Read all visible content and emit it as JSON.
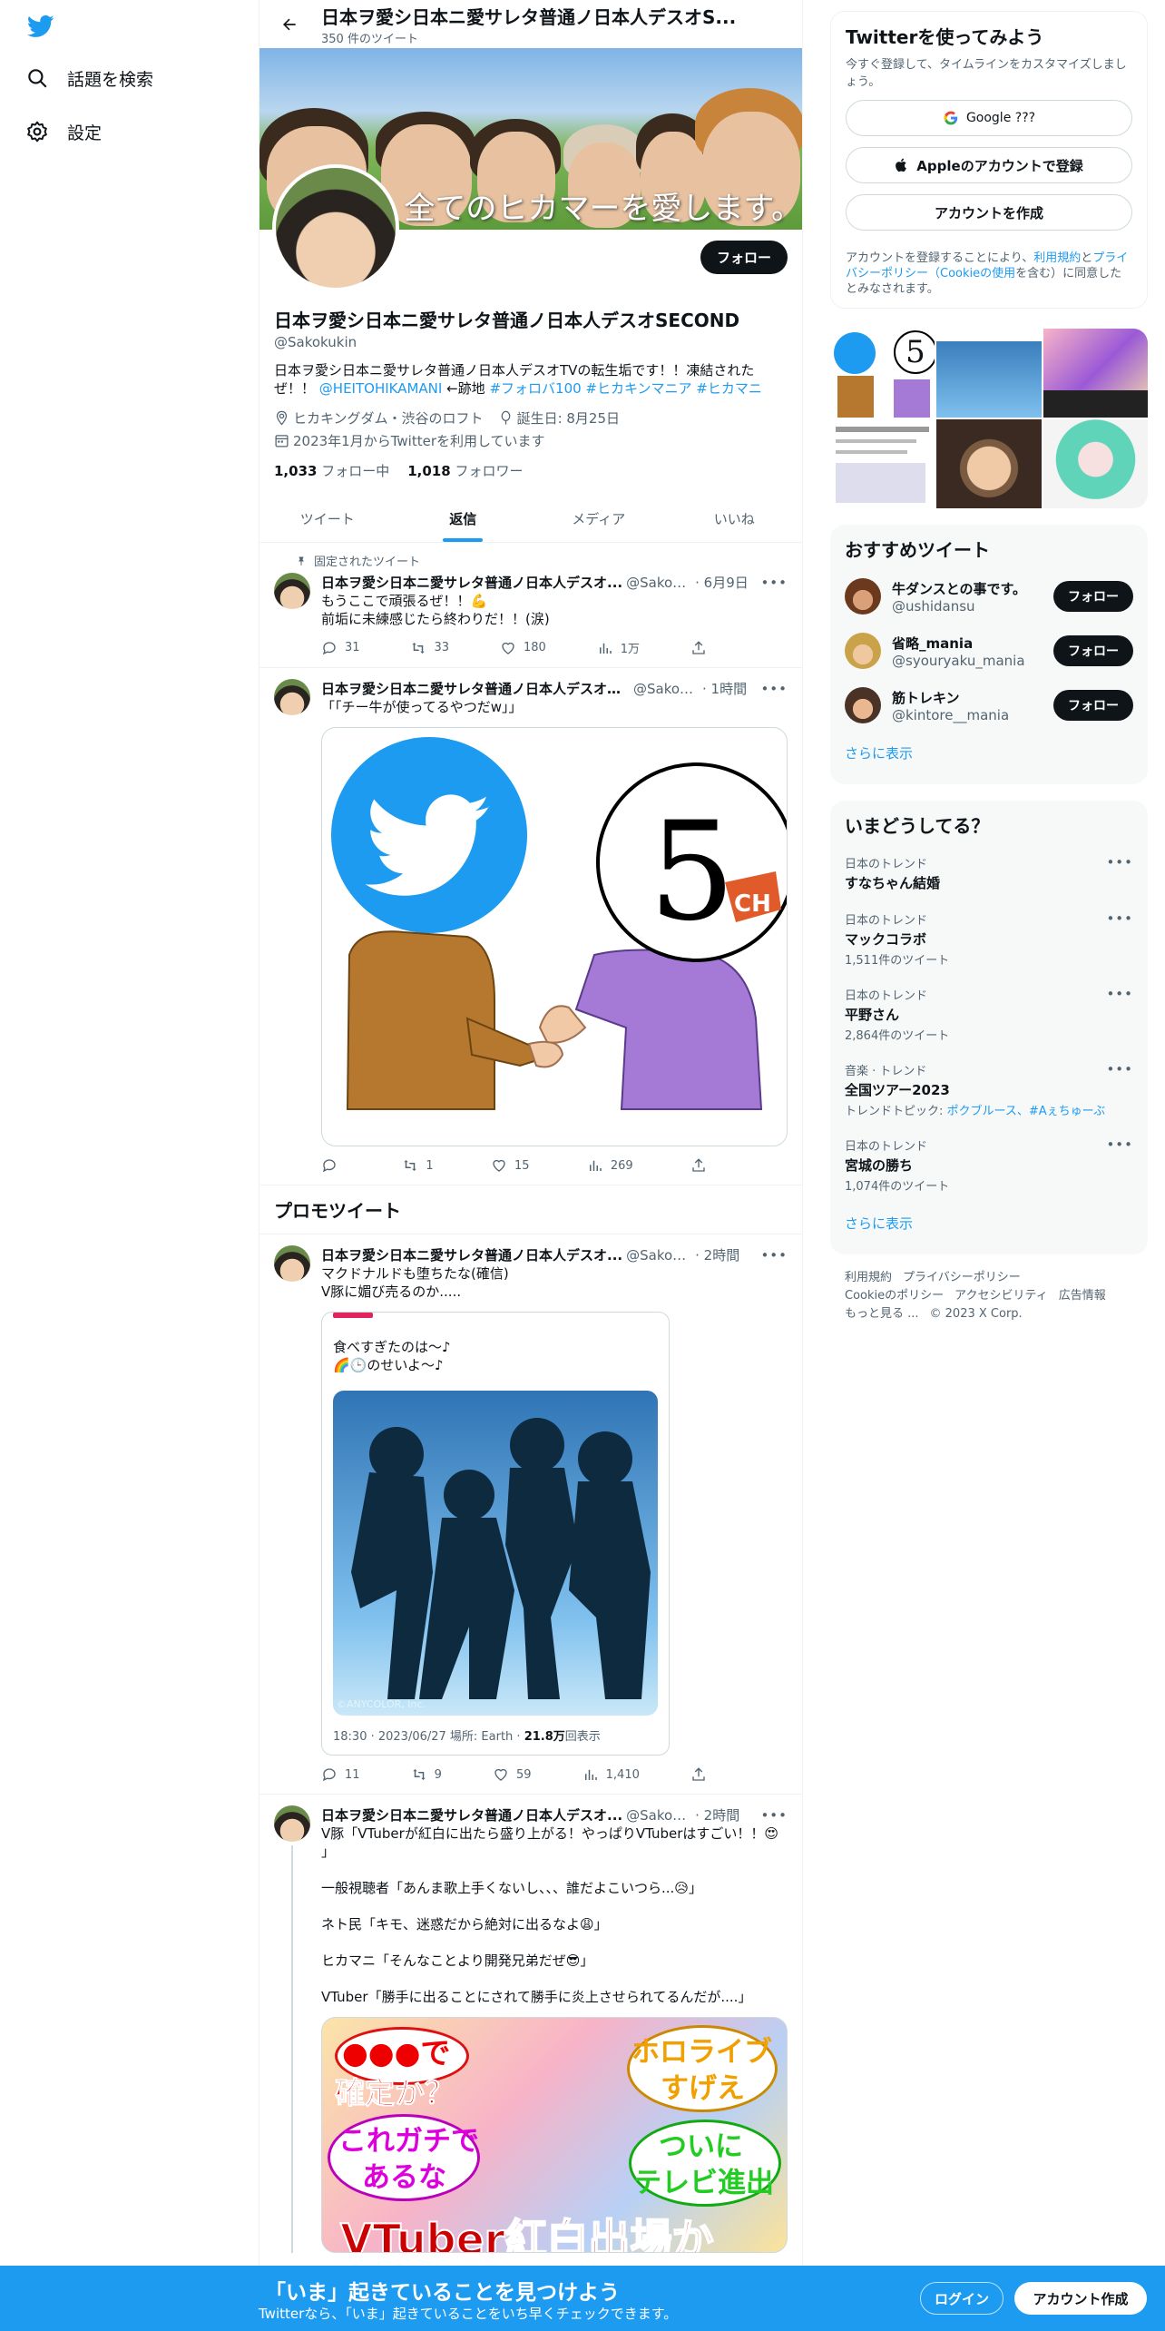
{
  "nav": {
    "explore_label": "話題を検索",
    "settings_label": "設定"
  },
  "header": {
    "title": "日本ヲ愛シ日本ニ愛サレタ普通ノ日本人デスオS...",
    "tweet_count": "350 件のツイート"
  },
  "banner": {
    "caption": "全てのヒカマーを愛します。"
  },
  "profile": {
    "follow_label": "フォロー",
    "name": "日本ヲ愛シ日本ニ愛サレタ普通ノ日本人デスオSECOND",
    "handle": "@Sakokukin",
    "bio_text": "日本ヲ愛シ日本ニ愛サレタ普通ノ日本人デスオTVの転生垢です！！凍結された",
    "bio_text2": "ぜ！！",
    "bio_mention": "@HEITOHIKAMANI",
    "bio_mid": " ←跡地 ",
    "bio_tags": "#フォロバ100 #ヒカキンマニア #ヒカマニ",
    "location": "ヒカキングダム・渋谷のロフト",
    "birthday": "誕生日: 8月25日",
    "joined": "2023年1月からTwitterを利用しています",
    "following_count": "1,033",
    "following_label": " フォロー中",
    "followers_count": "1,018",
    "followers_label": " フォロワー"
  },
  "tabs": [
    "ツイート",
    "返信",
    "メディア",
    "いいね"
  ],
  "tweets": [
    {
      "pinned_label": "固定されたツイート",
      "name": "日本ヲ愛シ日本ニ愛サレタ普通ノ日本人デスオ...",
      "handle": "@Sakok...",
      "time": "· 6月9日",
      "text": "もうここで頑張るぜ！！💪\n前垢に未練感じたら終わりだ！！(涙)",
      "replies": "31",
      "retweets": "33",
      "likes": "180",
      "views": "1万"
    },
    {
      "name": "日本ヲ愛シ日本ニ愛サレタ普通ノ日本人デスオS...",
      "handle": "@Sakok...",
      "time": "· 1時間",
      "text": "「「チー牛が使ってるやつだw」」",
      "media_label": "CH",
      "replies": "",
      "retweets": "1",
      "likes": "15",
      "views": "269"
    },
    {
      "name": "日本ヲ愛シ日本ニ愛サレタ普通ノ日本人デスオ...",
      "handle": "@Sakok...",
      "time": "· 2時間",
      "text": "マクドナルドも堕ちたな(確信)\nV豚に媚び売るのか.....",
      "quote_text": "食べすぎたのは〜♪\n🌈🕒のせいよ〜♪",
      "quote_watermark": "©ANYCOLOR, Inc.",
      "quote_meta_time": "18:30 · 2023/06/27 場所: Earth · ",
      "quote_meta_views": "21.8万",
      "quote_meta_views_label": "回表示",
      "replies": "11",
      "retweets": "9",
      "likes": "59",
      "views": "1,410"
    },
    {
      "name": "日本ヲ愛シ日本ニ愛サレタ普通ノ日本人デスオ...",
      "handle": "@Sakok...",
      "time": "· 2時間",
      "text": "V豚「VTuberが紅白に出たら盛り上がる！やっぱりVTuberはすごい！！😍\n」\n\n一般視聴者「あんま歌上手くないし、、、誰だよこいつら...😥」\n\nネト民「キモ、迷惑だから絶対に出るなよ😩」\n\nヒカマニ「そんなことより開発兄弟だぜ😎」\n\nVTuber「勝手に出ることにされて勝手に炎上させられてるんだが....」",
      "thumb_texts": [
        "●●●で",
        "確定か？",
        "これガチで",
        "あるな",
        "ホロライブ",
        "すげえ",
        "ついに",
        "テレビ進出",
        "VTuber紅白出場か"
      ]
    }
  ],
  "promo_title": "プロモツイート",
  "right": {
    "signup": {
      "title": "Twitterを使ってみよう",
      "subtitle": "今すぐ登録して、タイムラインをカスタマイズしましょう。",
      "google_label": "Google ???",
      "apple_label": "Appleのアカウントで登録",
      "create_label": "アカウントを作成",
      "legal_pre": "アカウントを登録することにより、",
      "legal_terms": "利用規約",
      "legal_and": "と",
      "legal_privacy": "プライバシーポリシー",
      "legal_cookie": "（Cookieの使用",
      "legal_post": "を含む）に同意したとみなされます。"
    },
    "recommended": {
      "title": "おすすめツイート",
      "users": [
        {
          "name": "牛ダンスとの事です。",
          "handle": "@ushidansu",
          "follow": "フォロー"
        },
        {
          "name": "省略_mania",
          "handle": "@syouryaku_mania",
          "follow": "フォロー"
        },
        {
          "name": "筋トレキン",
          "handle": "@kintore__mania",
          "follow": "フォロー"
        }
      ],
      "more": "さらに表示"
    },
    "trends": {
      "title": "いまどうしてる？",
      "items": [
        {
          "context": "日本のトレンド",
          "topic": "すなちゃん結婚",
          "count": ""
        },
        {
          "context": "日本のトレンド",
          "topic": "マックコラボ",
          "count": "1,511件のツイート"
        },
        {
          "context": "日本のトレンド",
          "topic": "平野さん",
          "count": "2,864件のツイート"
        },
        {
          "context": "音楽 · トレンド",
          "topic": "全国ツアー2023",
          "count_pre": "トレンドトピック: ",
          "count_link": "ポクブルース、#Aぇちゅーぶ"
        },
        {
          "context": "日本のトレンド",
          "topic": "宮城の勝ち",
          "count": "1,074件のツイート"
        }
      ],
      "more": "さらに表示"
    },
    "footer": {
      "links": [
        "利用規約",
        "プライバシーポリシー",
        "Cookieのポリシー",
        "アクセシビリティ",
        "広告情報",
        "もっと見る ...",
        "© 2023 X Corp."
      ]
    }
  },
  "bottom_bar": {
    "title": "「いま」起きていることを見つけよう",
    "subtitle": "Twitterなら、「いま」起きていることをいち早くチェックできます。",
    "login": "ログイン",
    "signup": "アカウント作成"
  },
  "colors": {
    "accent": "#1d9bf0",
    "text": "#0f1419",
    "muted": "#536471"
  }
}
